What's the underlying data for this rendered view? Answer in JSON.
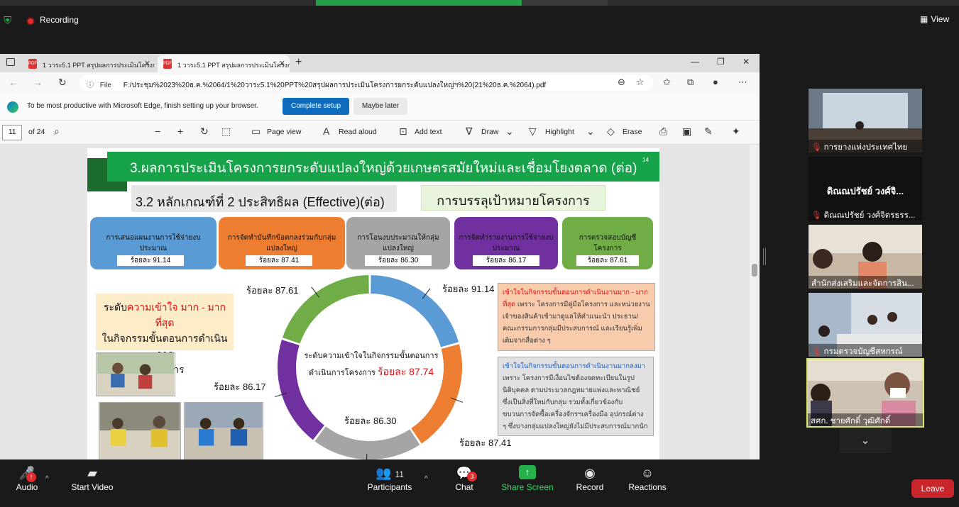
{
  "zoom": {
    "recording_label": "Recording",
    "view_label": "View",
    "bottom": {
      "audio": "Audio",
      "audio_badge": "!",
      "start_video": "Start Video",
      "participants": "Participants",
      "participants_count": "11",
      "chat": "Chat",
      "chat_badge": "3",
      "share_screen": "Share Screen",
      "record": "Record",
      "reactions": "Reactions",
      "leave": "Leave"
    },
    "participants_strip": [
      {
        "name": "การยางแห่งประเทศไทย",
        "muted": true
      },
      {
        "name": "ดิณณปรัชย์ วงศ์จิตรธรร...",
        "big_name": "ดิณณปรัชย์ วงศ์จิ...",
        "muted": true
      },
      {
        "name": "สำนักส่งเสริมและจัดการสิน...",
        "muted": false
      },
      {
        "name": "กรมตรวจบัญชีสหกรณ์",
        "muted": true
      },
      {
        "name": "สศก. ชายศักดิ์ วุฒิศักดิ์",
        "muted": false
      }
    ]
  },
  "edge": {
    "tabs": [
      {
        "title": "1 วาระ5.1 PPT สรุปผลการประเมินโครงการ",
        "active": false
      },
      {
        "title": "1 วาระ5.1 PPT สรุปผลการประเมินโครงการ",
        "active": true
      }
    ],
    "address": {
      "file_label": "File",
      "url": "F:/ประชุม%2023%20ธ.ค.%2064/1%20วาระ5.1%20PPT%20สรุปผลการประเมินโครงการยกระดับแปลงใหญ่ฯ%20(21%20ธ.ค.%2064).pdf"
    },
    "infobar": {
      "message": "To be most productive with Microsoft Edge, finish setting up your browser.",
      "complete_setup": "Complete setup",
      "maybe_later": "Maybe later"
    },
    "pdf_toolbar": {
      "page_number": "11",
      "page_total": "of 24",
      "page_view": "Page view",
      "read_aloud": "Read aloud",
      "add_text": "Add text",
      "draw": "Draw",
      "highlight": "Highlight",
      "erase": "Erase"
    }
  },
  "slide": {
    "title": "3.ผลการประเมินโครงการยกระดับแปลงใหญ่ด้วยเกษตรสมัยใหม่และเชื่อมโยงตลาด (ต่อ)",
    "page_no": "14",
    "criterion": "3.2 หลักเกณฑ์ที่ 2 ประสิทธิผล (Effective)(ต่อ)",
    "goal": "การบรรลุเป้าหมายโครงการ",
    "cards": [
      {
        "label": "การเสนอแผนงานการใช้จ่ายงบประมาณ",
        "pct": "ร้อยละ 91.14",
        "color": "#5b9bd5"
      },
      {
        "label": "การจัดทำบันทึกข้อตกลงร่วมกับกลุ่มแปลงใหญ่",
        "pct": "ร้อยละ 87.41",
        "color": "#ed7d31"
      },
      {
        "label": "การโอนงบประมาณให้กลุ่มแปลงใหญ่",
        "pct": "ร้อยละ 86.30",
        "color": "#a5a5a5"
      },
      {
        "label": "การจัดทำรายงานการใช้จ่ายงบประมาณ",
        "pct": "ร้อยละ 86.17",
        "color": "#7030a0"
      },
      {
        "label": "การตรวจสอบบัญชีโครงการ",
        "pct": "ร้อยละ 87.61",
        "color": "#70ad47"
      }
    ],
    "level_box": {
      "prefix": "ระดับ",
      "highlight": "ความเข้าใจ มาก - มากที่สุด",
      "line2": "ในกิจกรรมขั้นตอนการดำเนินการ",
      "line3": "โครงการ"
    },
    "center_text": {
      "line1": "ระดับความเข้าใจในกิจกรรมขั้นตอนการ",
      "line2": "ดำเนินการโครงการ",
      "value": "ร้อยละ 87.74"
    },
    "note_high": {
      "highlight": "เข้าใจในกิจกรรมขั้นตอนการดำเนินงานมาก - มากที่สุด",
      "text": " เพราะ โครงการมีคู่มือโครงการ และหน่วยงานเจ้าของสินค้าเข้ามาดูแลให้คำแนะนำ ประธาน/คณะกรรมการกลุ่มมีประสบการณ์ และเรียนรู้เพิ่มเติมจากสื่อต่าง ๆ"
    },
    "note_mid": {
      "highlight": "เข้าใจในกิจกรรมขั้นตอนการดำเนินงานมากลงมา",
      "text": " เพราะ โครงการมีเงื่อนไขต้องจดทะเบียนในรูปนิติบุคคล ตามประมวลกฎหมายแพ่งและพาณิชย์ ซึ่งเป็นสิ่งที่ใหม่กับกลุ่ม รวมทั้งเกี่ยวข้องกับขบวนการจัดซื้อเครื่องจักรฯเครื่องมือ อุปกรณ์ต่าง ๆ ซึ่งบางกลุ่มแปลงใหญ่ยังไม่มีประสบการณ์มากนัก"
    }
  },
  "chart_data": {
    "type": "pie",
    "donut": true,
    "categories": [
      "การเสนอแผนงานการใช้จ่ายงบประมาณ",
      "การจัดทำบันทึกข้อตกลงร่วมกับกลุ่มแปลงใหญ่",
      "การโอนงบประมาณให้กลุ่มแปลงใหญ่",
      "การจัดทำรายงานการใช้จ่ายงบประมาณ",
      "การตรวจสอบบัญชีโครงการ"
    ],
    "values": [
      91.14,
      87.41,
      86.3,
      86.17,
      87.61
    ],
    "labels": [
      "ร้อยละ 91.14",
      "ร้อยละ 87.41",
      "ร้อยละ 86.30",
      "ร้อยละ 86.17",
      "ร้อยละ 87.61"
    ],
    "colors": [
      "#5b9bd5",
      "#ed7d31",
      "#a5a5a5",
      "#7030a0",
      "#70ad47"
    ],
    "center_value": "ร้อยละ 87.74"
  }
}
